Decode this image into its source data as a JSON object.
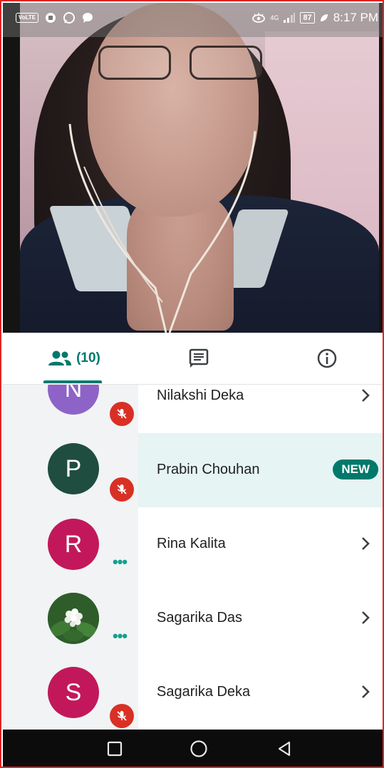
{
  "status_bar": {
    "left_badge": "VoLTE",
    "network": "4G",
    "battery": "87",
    "time": "8:17 PM"
  },
  "tabs": {
    "people_count": "(10)"
  },
  "participants": [
    {
      "initial": "N",
      "name": "Nilakshi Deka",
      "avatar_color": "#8e63c7",
      "status": "muted",
      "trailing": "chevron"
    },
    {
      "initial": "P",
      "name": "Prabin Chouhan",
      "avatar_color": "#1f4d3f",
      "status": "muted",
      "trailing": "new-badge",
      "badge": "NEW",
      "highlighted": true
    },
    {
      "initial": "R",
      "name": "Rina Kalita",
      "avatar_color": "#c2185b",
      "status": "speaking",
      "trailing": "chevron"
    },
    {
      "initial": "",
      "name": "Sagarika Das",
      "avatar_color": "#2f5d2a",
      "avatar_type": "photo-flower",
      "status": "speaking",
      "trailing": "chevron"
    },
    {
      "initial": "S",
      "name": "Sagarika Deka",
      "avatar_color": "#c2185b",
      "status": "muted",
      "trailing": "chevron"
    }
  ],
  "colors": {
    "accent": "#00796b",
    "mute_red": "#d93025",
    "highlight_row": "#e6f4f3",
    "frame_border": "#e02424"
  },
  "icons": {
    "people_tab": "people-icon",
    "chat_tab": "chat-icon",
    "info_tab": "info-icon",
    "mute": "mic-off-icon",
    "row_action": "chevron-right-icon",
    "nav": [
      "recents-square-icon",
      "home-circle-icon",
      "back-triangle-icon"
    ]
  }
}
